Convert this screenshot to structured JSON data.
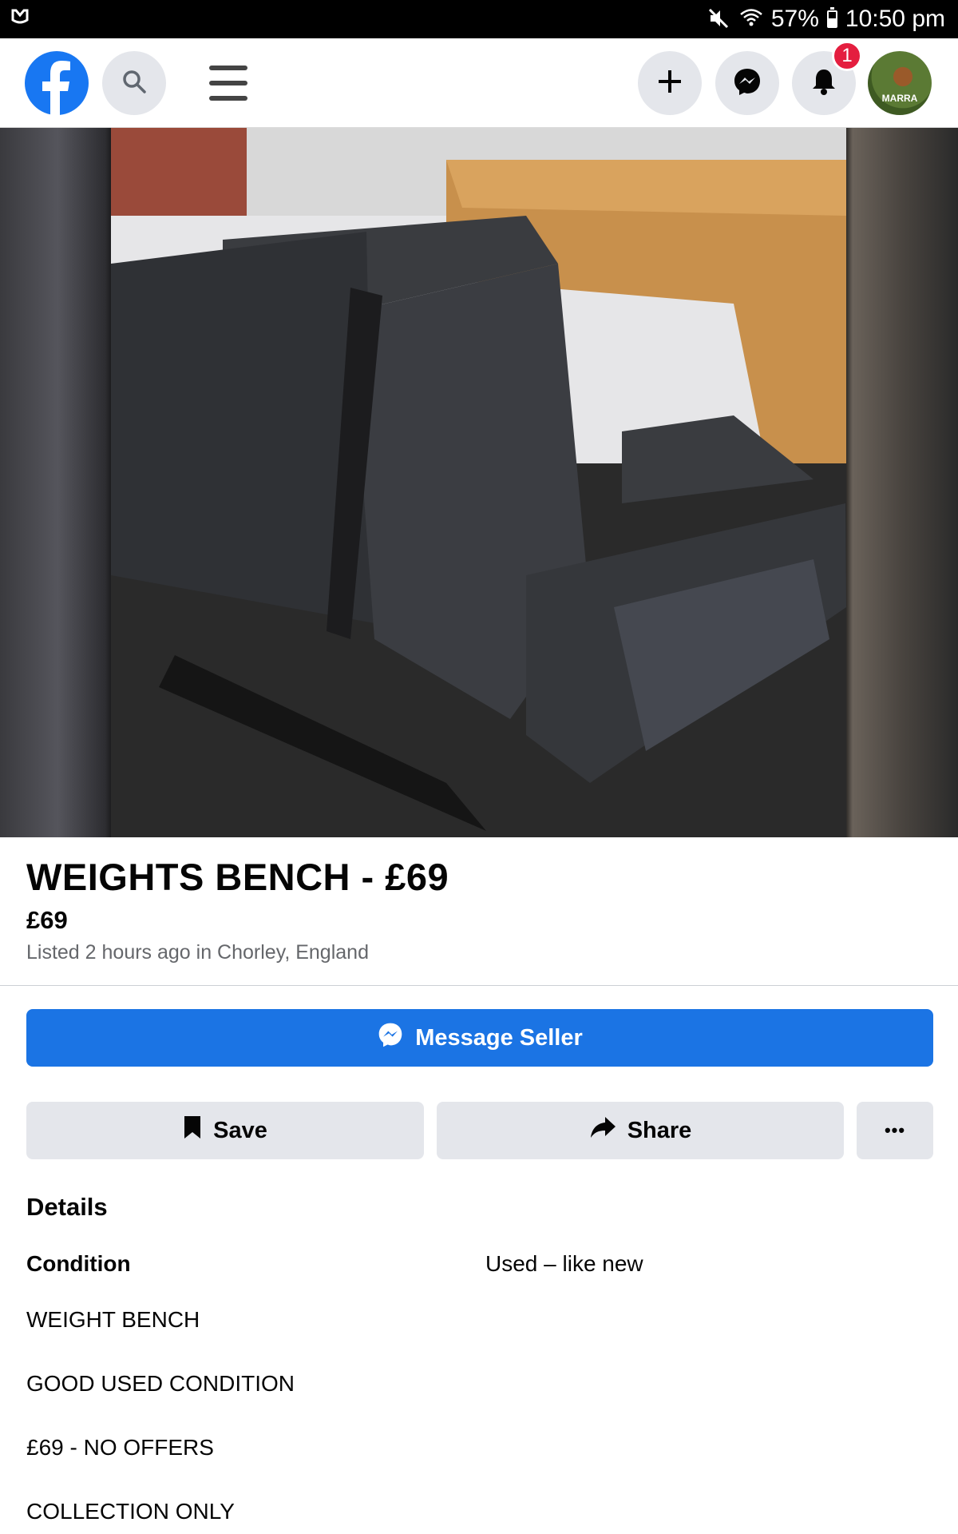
{
  "status_bar": {
    "battery": "57%",
    "time": "10:50 pm",
    "battery_level": 0.57
  },
  "header": {
    "notification_count": "1",
    "avatar_text": "MARRA",
    "icons": [
      "facebook-logo",
      "search-icon",
      "menu-icon",
      "plus-icon",
      "messenger-icon",
      "bell-icon"
    ]
  },
  "listing": {
    "title": "WEIGHTS BENCH - £69",
    "price": "£69",
    "listed": "Listed 2 hours ago in Chorley, England"
  },
  "actions": {
    "message_label": "Message Seller",
    "save_label": "Save",
    "share_label": "Share",
    "more_label": "•••"
  },
  "details": {
    "heading": "Details",
    "condition_label": "Condition",
    "condition_value": "Used – like new",
    "description": [
      "WEIGHT BENCH",
      "GOOD USED CONDITION",
      "£69 - NO OFFERS",
      "COLLECTION ONLY"
    ]
  },
  "colors": {
    "brand_blue": "#1877f2",
    "button_blue": "#1b74e4",
    "badge_red": "#e41e3f",
    "button_gray": "#e4e6eb"
  }
}
